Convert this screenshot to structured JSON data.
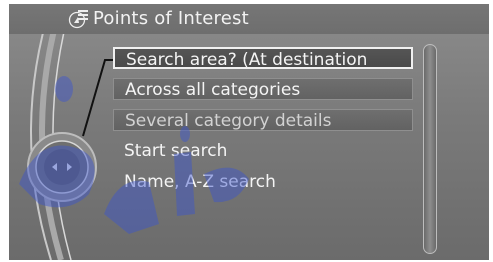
{
  "header": {
    "title": "Points of Interest",
    "icon": "points-of-interest-icon"
  },
  "menu": {
    "items": [
      {
        "label": "Search area? (At destination",
        "style": "selected"
      },
      {
        "label": "Across all categories",
        "style": "bar"
      },
      {
        "label": "Several category details",
        "style": "bar-dim"
      },
      {
        "label": "Start search",
        "style": "plain"
      },
      {
        "label": "Name, A-Z search",
        "style": "plain"
      }
    ]
  },
  "controller": {
    "icon": "idrive-controller-icon"
  },
  "colors": {
    "screen_background": "#7a7a7a",
    "text": "#f4f4f4",
    "watermark": "#3b55d0"
  }
}
